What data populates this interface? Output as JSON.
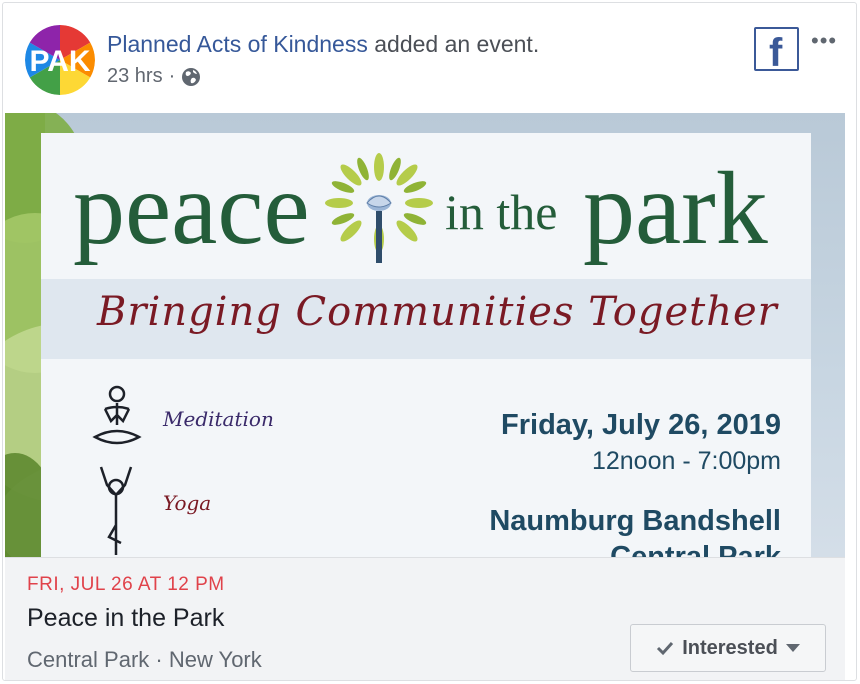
{
  "post": {
    "page_name": "Planned Acts of Kindness",
    "action_text": " added an event.",
    "timestamp": "23 hrs",
    "separator": "·",
    "avatar_text": "PAK"
  },
  "badge": {
    "label": "f"
  },
  "more_menu": {
    "label": "•••"
  },
  "poster": {
    "title_peace": "peace",
    "title_in_the": "in the",
    "title_park": "park",
    "subtitle": "Bringing Communities Together",
    "activities": [
      "Meditation",
      "Yoga"
    ],
    "date": "Friday, July 26, 2019",
    "time": "12noon - 7:00pm",
    "venue": "Naumburg Bandshell",
    "venue_line2": "Central Park"
  },
  "event": {
    "date_line": "FRI, JUL 26 AT 12 PM",
    "title": "Peace in the Park",
    "location": "Central Park · New York",
    "interested_label": "Interested"
  },
  "colors": {
    "link": "#365899",
    "date_red": "#e0424a",
    "poster_green": "#245d3a",
    "poster_maroon": "#7a1a24",
    "poster_navy": "#1f4a63"
  }
}
